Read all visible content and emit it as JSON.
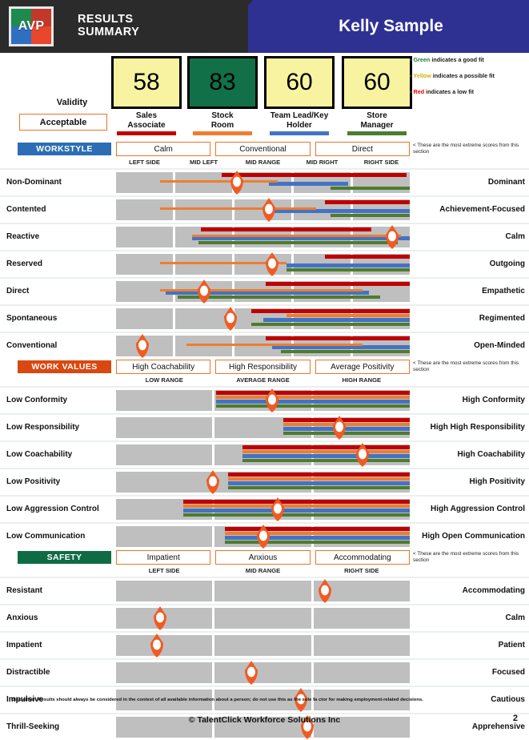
{
  "header": {
    "logo_text": "AVP",
    "title_line1": "RESULTS",
    "title_line2": "SUMMARY",
    "candidate_name": "Kelly Sample",
    "dark_color": "#2b2b2b",
    "blue_color": "#2E3192"
  },
  "validity": {
    "label": "Validity",
    "value": "Acceptable"
  },
  "legend": [
    {
      "color_word": "Green",
      "color_hex": "#1d7a44",
      "text": " indicates a good fit"
    },
    {
      "color_word": "Yellow",
      "color_hex": "#D4B106",
      "text": " indicates a possible fit"
    },
    {
      "color_word": "Red",
      "color_hex": "#e00000",
      "text": " indicates a low fit"
    }
  ],
  "jobs": [
    {
      "score": "58",
      "title": "Sales\nAssociate",
      "title_l1": "Sales",
      "title_l2": "Associate",
      "fit": "yellow",
      "color": "#C00000"
    },
    {
      "score": "83",
      "title": "Stock Room",
      "title_l1": "Stock",
      "title_l2": "Room",
      "fit": "green",
      "color": "#ED7D31"
    },
    {
      "score": "60",
      "title": "Team Lead/Key Holder",
      "title_l1": "Team Lead/Key",
      "title_l2": "Holder",
      "fit": "yellow",
      "color": "#4472C4"
    },
    {
      "score": "60",
      "title": "Store Manager",
      "title_l1": "Store",
      "title_l2": "Manager",
      "fit": "yellow",
      "color": "#4C7C2F"
    }
  ],
  "extreme_note": "< These are the most extreme scores from this section",
  "sections": [
    {
      "name": "WORKSTYLE",
      "tag_class": "tag-ws",
      "extremes": [
        "Calm",
        "Conventional",
        "Direct"
      ],
      "axis": [
        "LEFT SIDE",
        "MID LEFT",
        "MID RANGE",
        "MID RIGHT",
        "RIGHT SIDE"
      ],
      "segments": 5,
      "rows": [
        {
          "left": "Non-Dominant",
          "right": "Dominant",
          "marker": 41,
          "thin": [
            15,
            55
          ],
          "bars": [
            [
              36,
              99
            ],
            [
              52,
              79
            ],
            [
              73,
              100
            ]
          ]
        },
        {
          "left": "Contented",
          "right": "Achievement-Focused",
          "marker": 52,
          "thin": [
            15,
            68
          ],
          "bars": [
            [
              71,
              100
            ],
            [
              52,
              100
            ],
            [
              73,
              100
            ]
          ]
        },
        {
          "left": "Reactive",
          "right": "Calm",
          "marker": 94,
          "thin": [
            26,
            97
          ],
          "bars": [
            [
              29,
              87
            ],
            [
              26,
              100
            ],
            [
              28,
              96
            ]
          ]
        },
        {
          "left": "Reserved",
          "right": "Outgoing",
          "marker": 53,
          "thin": [
            15,
            58
          ],
          "bars": [
            [
              71,
              100
            ],
            [
              58,
              100
            ],
            [
              58,
              100
            ]
          ]
        },
        {
          "left": "Direct",
          "right": "Empathetic",
          "marker": 30,
          "thin": [
            15,
            84
          ],
          "bars": [
            [
              51,
              100
            ],
            [
              17,
              86
            ],
            [
              21,
              90
            ]
          ]
        },
        {
          "left": "Spontaneous",
          "right": "Regimented",
          "marker": 39,
          "thin": [],
          "bars": [
            [
              46,
              100
            ],
            [
              58,
              100
            ],
            [
              50,
              100
            ],
            [
              46,
              100
            ]
          ]
        },
        {
          "left": "Conventional",
          "right": "Open-Minded",
          "marker": 9,
          "thin": [
            24,
            84
          ],
          "bars": [
            [
              51,
              100
            ],
            [
              53,
              100
            ],
            [
              56,
              100
            ]
          ]
        }
      ]
    },
    {
      "name": "WORK VALUES",
      "tag_class": "tag-wv",
      "extremes": [
        "High Coachability",
        "High Responsibility",
        "Average Positivity"
      ],
      "axis": [
        "LOW RANGE",
        "AVERAGE RANGE",
        "HIGH RANGE"
      ],
      "segments": 3,
      "rows": [
        {
          "left": "Low Conformity",
          "right": "High Conformity",
          "marker": 53,
          "thin": [],
          "bars": [
            [
              34,
              100
            ],
            [
              34,
              100
            ],
            [
              34,
              100
            ],
            [
              34,
              100
            ]
          ]
        },
        {
          "left": "Low Responsibility",
          "right": "High High Responsibility",
          "marker": 76,
          "thin": [],
          "bars": [
            [
              57,
              100
            ],
            [
              57,
              100
            ],
            [
              57,
              100
            ],
            [
              57,
              100
            ]
          ]
        },
        {
          "left": "Low Coachability",
          "right": "High Coachability",
          "marker": 84,
          "thin": [],
          "bars": [
            [
              43,
              100
            ],
            [
              43,
              100
            ],
            [
              43,
              100
            ],
            [
              43,
              100
            ]
          ]
        },
        {
          "left": "Low Positivity",
          "right": "High Positivity",
          "marker": 33,
          "thin": [],
          "bars": [
            [
              38,
              100
            ],
            [
              38,
              100
            ],
            [
              38,
              100
            ],
            [
              38,
              100
            ]
          ]
        },
        {
          "left": "Low Aggression Control",
          "right": "High Aggression Control",
          "marker": 55,
          "thin": [],
          "bars": [
            [
              23,
              100
            ],
            [
              23,
              100
            ],
            [
              23,
              100
            ],
            [
              23,
              100
            ]
          ]
        },
        {
          "left": "Low Communication",
          "right": "High Open Communication",
          "marker": 50,
          "thin": [],
          "bars": [
            [
              37,
              100
            ],
            [
              37,
              100
            ],
            [
              37,
              100
            ],
            [
              37,
              100
            ]
          ]
        }
      ]
    },
    {
      "name": "SAFETY",
      "tag_class": "tag-sf",
      "extremes": [
        "Impatient",
        "Anxious",
        "Accommodating"
      ],
      "axis": [
        "LEFT SIDE",
        "MID RANGE",
        "RIGHT SIDE"
      ],
      "segments": 3,
      "rows": [
        {
          "left": "Resistant",
          "right": "Accommodating",
          "marker": 71,
          "thin": [],
          "bars": []
        },
        {
          "left": "Anxious",
          "right": "Calm",
          "marker": 15,
          "thin": [],
          "bars": []
        },
        {
          "left": "Impatient",
          "right": "Patient",
          "marker": 14,
          "thin": [],
          "bars": []
        },
        {
          "left": "Distractible",
          "right": "Focused",
          "marker": 46,
          "thin": [],
          "bars": []
        },
        {
          "left": "Impulsive",
          "right": "Cautious",
          "marker": 63,
          "thin": [],
          "bars": []
        },
        {
          "left": "Thrill-Seeking",
          "right": "Apprehensive",
          "marker": 65,
          "thin": [],
          "bars": []
        }
      ]
    }
  ],
  "footer": {
    "disclaimer": "Disclaimer: Results should always be considered in the context of all available information about a person; do not use this as the sole fa ctor for making employment-related decisions.",
    "copyright": "© TalentClick Workforce Solutions Inc",
    "page_number": "2"
  }
}
